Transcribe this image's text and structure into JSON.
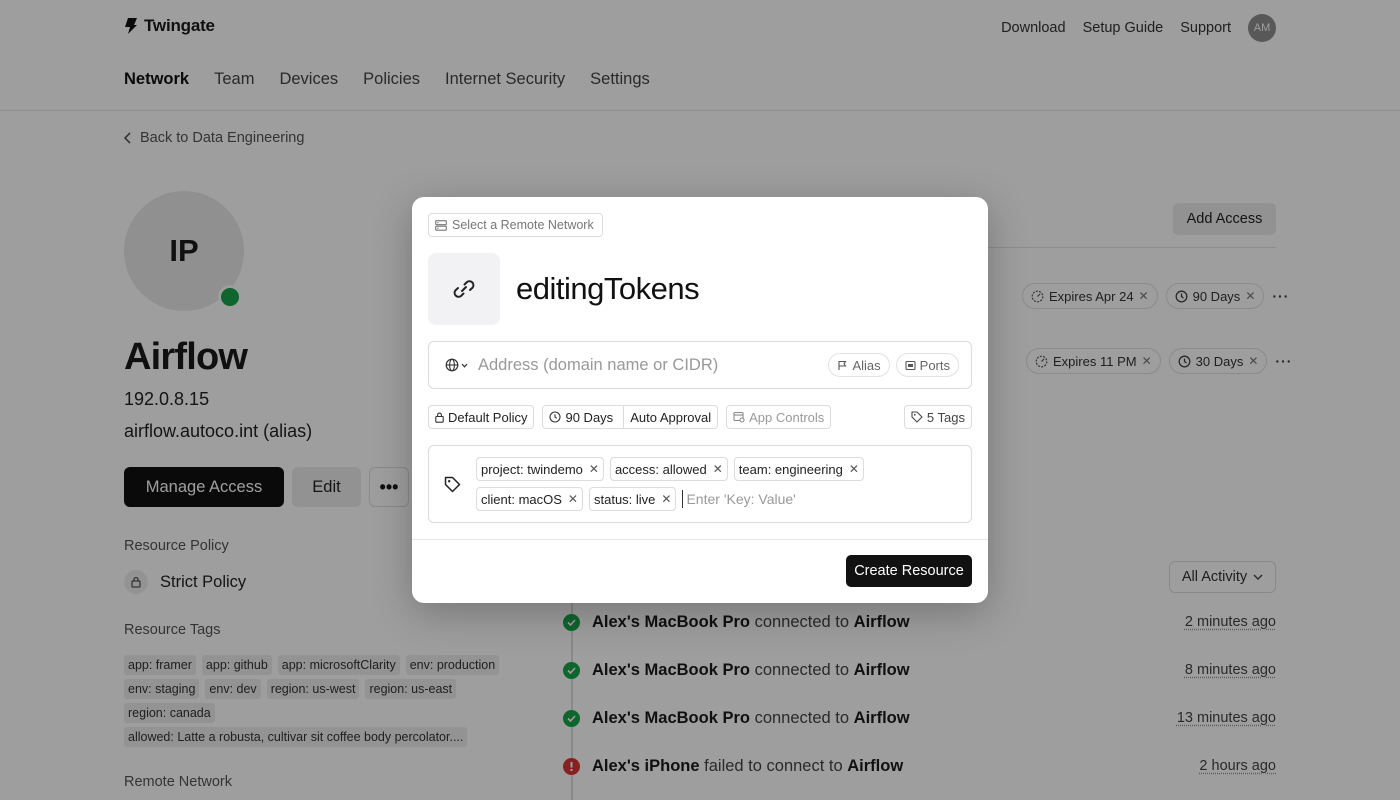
{
  "header": {
    "brand": "Twingate",
    "links": [
      "Download",
      "Setup Guide",
      "Support"
    ],
    "user_initials": "AM",
    "nav": [
      {
        "label": "Network",
        "active": true
      },
      {
        "label": "Team",
        "active": false
      },
      {
        "label": "Devices",
        "active": false
      },
      {
        "label": "Policies",
        "active": false
      },
      {
        "label": "Internet Security",
        "active": false
      },
      {
        "label": "Settings",
        "active": false
      }
    ]
  },
  "page": {
    "back_label": "Back to Data Engineering",
    "avatar_initials": "IP",
    "resource_name": "Airflow",
    "ip": "192.0.8.15",
    "alias": "airflow.autoco.int (alias)",
    "manage_access_label": "Manage Access",
    "edit_label": "Edit",
    "more_label": "•••",
    "resource_policy_label": "Resource Policy",
    "resource_policy_value": "Strict Policy",
    "resource_tags_label": "Resource Tags",
    "resource_tags": [
      "app: framer",
      "app: github",
      "app: microsoftClarity",
      "env: production",
      "env: staging",
      "env: dev",
      "region: us-west",
      "region: us-east",
      "region: canada",
      "allowed: Latte a robusta, cultivar sit coffee body percolator...."
    ],
    "remote_network_label": "Remote Network",
    "add_access_label": "Add Access",
    "access_rows": [
      {
        "expires": "Expires Apr 24",
        "duration": "90 Days"
      },
      {
        "expires": "Expires 11 PM",
        "duration": "30 Days"
      }
    ],
    "activity_filter": "All Activity",
    "activity": [
      {
        "device": "Alex's MacBook Pro",
        "action": "connected to",
        "target": "Airflow",
        "time": "2 minutes ago",
        "status": "ok"
      },
      {
        "device": "Alex's MacBook Pro",
        "action": "connected to",
        "target": "Airflow",
        "time": "8 minutes ago",
        "status": "ok"
      },
      {
        "device": "Alex's MacBook Pro",
        "action": "connected to",
        "target": "Airflow",
        "time": "13 minutes ago",
        "status": "ok"
      },
      {
        "device": "Alex's iPhone",
        "action": "failed to connect to",
        "target": "Airflow",
        "time": "2 hours ago",
        "status": "fail"
      }
    ]
  },
  "modal": {
    "network_select": "Select a Remote Network",
    "title": "editingTokens",
    "address_placeholder": "Address (domain name or CIDR)",
    "address_value": "",
    "alias_label": "Alias",
    "ports_label": "Ports",
    "policy_label": "Default Policy",
    "duration_label": "90 Days",
    "approval_label": "Auto Approval",
    "app_controls_label": "App Controls",
    "tags_count_label": "5 Tags",
    "tags": [
      "project: twindemo",
      "access: allowed",
      "team: engineering",
      "client: macOS",
      "status: live"
    ],
    "tag_placeholder": "Enter 'Key: Value'",
    "create_label": "Create Resource"
  },
  "colors": {
    "success": "#17a34a",
    "danger": "#d93636",
    "primary_button": "#111111"
  }
}
